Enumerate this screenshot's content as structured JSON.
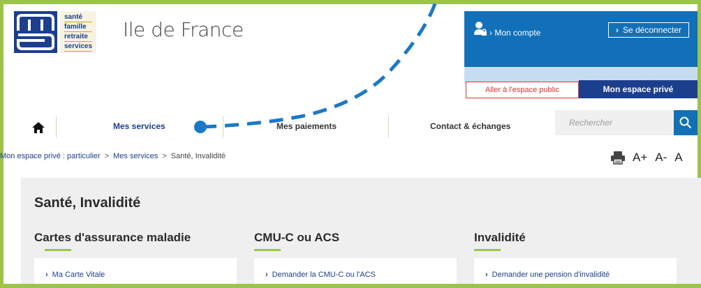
{
  "header": {
    "logo": {
      "lines": [
        "santé",
        "famille",
        "retraite",
        "services"
      ],
      "mark": "msa"
    },
    "region": "Ile de France"
  },
  "account": {
    "my_account": "Mon compte",
    "logout": "Se déconnecter",
    "public_space": "Aller à l'espace public",
    "private_space": "Mon espace privé"
  },
  "nav": {
    "items": [
      {
        "label": "Mes services",
        "active": true
      },
      {
        "label": "Mes paiements",
        "active": false
      },
      {
        "label": "Contact & échanges",
        "active": false
      }
    ],
    "search_placeholder": "Rechercher"
  },
  "breadcrumb": {
    "items": [
      "Mon espace privé : particulier",
      "Mes services",
      "Santé, Invalidité"
    ],
    "separator": ">"
  },
  "tools": {
    "font_plus": "A+",
    "font_minus": "A-",
    "font_reset": "A"
  },
  "main": {
    "title": "Santé, Invalidité",
    "columns": [
      {
        "heading": "Cartes d'assurance maladie",
        "link": "Ma Carte Vitale"
      },
      {
        "heading": "CMU-C ou ACS",
        "link": "Demander la CMU-C ou l'ACS"
      },
      {
        "heading": "Invalidité",
        "link": "Demander une pension d'invalidité"
      }
    ]
  },
  "colors": {
    "frame": "#9dc44a",
    "brand_blue": "#1170b8",
    "dark_blue": "#1c3f8d",
    "public_red": "#e03232",
    "panel_grey": "#efefef"
  }
}
